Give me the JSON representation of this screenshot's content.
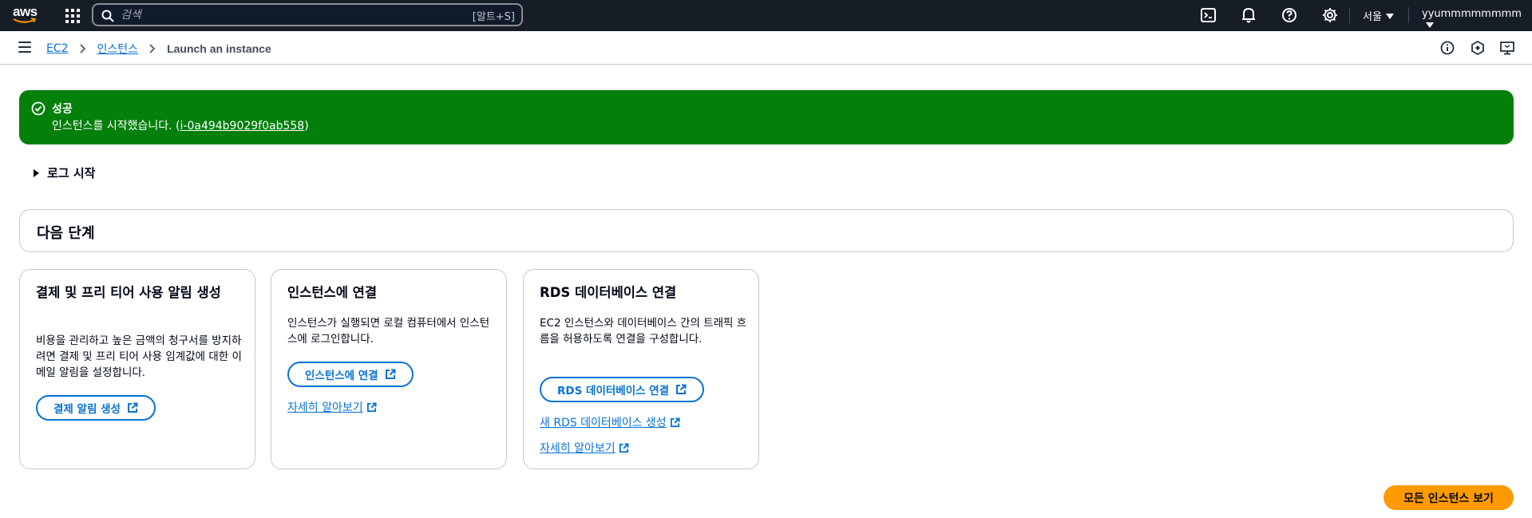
{
  "topnav": {
    "logo_text": "aws",
    "search_placeholder": "검색",
    "search_shortcut": "[알트+S]",
    "region": "서울",
    "user": "yyummmmmmmm"
  },
  "breadcrumb": {
    "items": [
      "EC2",
      "인스턴스"
    ],
    "current": "Launch an instance"
  },
  "flash": {
    "title": "성공",
    "message": "인스턴스를 시작했습니다.",
    "instance_id": "i-0a494b9029f0ab558",
    "color": "#037f0c"
  },
  "log_expander": "로그 시작",
  "next_steps": {
    "title": "다음 단계",
    "cards": [
      {
        "title": "결제 및 프리 티어 사용 알림 생성",
        "description": "비용을 관리하고 높은 금액의 청구서를 방지하려면 결제 및 프리 티어 사용 임계값에 대한 이메일 알림을 설정합니다.",
        "button": "결제 알림 생성"
      },
      {
        "title": "인스턴스에 연결",
        "description": "인스턴스가 실행되면 로컬 컴퓨터에서 인스턴스에 로그인합니다.",
        "button": "인스턴스에 연결",
        "link": "자세히 알아보기"
      },
      {
        "title": "RDS 데이터베이스 연결",
        "description": "EC2 인스턴스와 데이터베이스 간의 트래픽 흐름을 허용하도록 연결을 구성합니다.",
        "button": "RDS 데이터베이스 연결",
        "link1": "새 RDS 데이터베이스 생성",
        "link2": "자세히 알아보기"
      }
    ]
  },
  "view_all_button": "모든 인스턴스 보기",
  "colors": {
    "nav_bg": "#161d26",
    "link": "#0972d3",
    "primary": "#ff9900"
  }
}
